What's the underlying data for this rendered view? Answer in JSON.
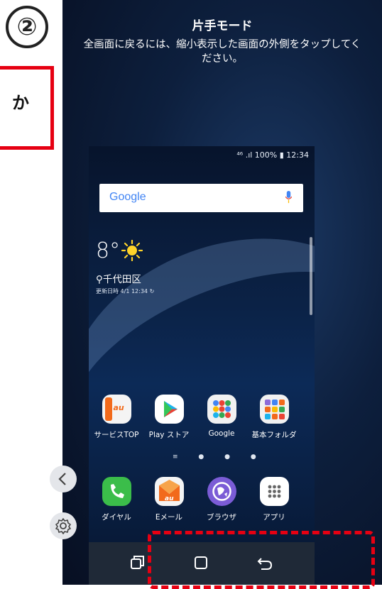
{
  "step_badge": "②",
  "callout_text": "か",
  "header": {
    "title": "片手モード",
    "description_line1": "全画面に戻るには、縮小表示した画面の外側をタップしてく",
    "description_line2": "ださい。"
  },
  "status_bar": "⁴⁶ .ıl 100% ▮ 12:34",
  "search_widget": {
    "logo": "Google",
    "mic_icon": "mic-icon"
  },
  "weather": {
    "temp": "8°",
    "location": "千代田区",
    "updated": "更新日時 4/1  12:34"
  },
  "apps_row1": [
    {
      "label": "サービスTOP",
      "icon": "au-service-icon",
      "color": "#f26a1b"
    },
    {
      "label": "Play ストア",
      "icon": "play-store-icon",
      "color": "#ffffff"
    },
    {
      "label": "Google",
      "icon": "google-folder-icon",
      "color": "#f1f1f1"
    },
    {
      "label": "基本フォルダ",
      "icon": "basic-folder-icon",
      "color": "#f1f1f1"
    }
  ],
  "apps_row2": [
    {
      "label": "ダイヤル",
      "icon": "phone-icon",
      "color": "#3bbd4a"
    },
    {
      "label": "Eメール",
      "icon": "au-mail-icon",
      "color": "#f26a1b"
    },
    {
      "label": "ブラウザ",
      "icon": "browser-icon",
      "color": "#7b5cd6"
    },
    {
      "label": "アプリ",
      "icon": "apps-grid-icon",
      "color": "#ffffff"
    }
  ],
  "page_indicator": "≡ ● ● ●",
  "side_buttons": {
    "back": "chevron-left-icon",
    "settings": "gear-icon"
  },
  "nav_bar": {
    "recent": "recent-apps-icon",
    "home": "home-icon",
    "back": "back-icon"
  },
  "colors": {
    "highlight": "#e60012",
    "nav_bg": "#1f2937"
  }
}
